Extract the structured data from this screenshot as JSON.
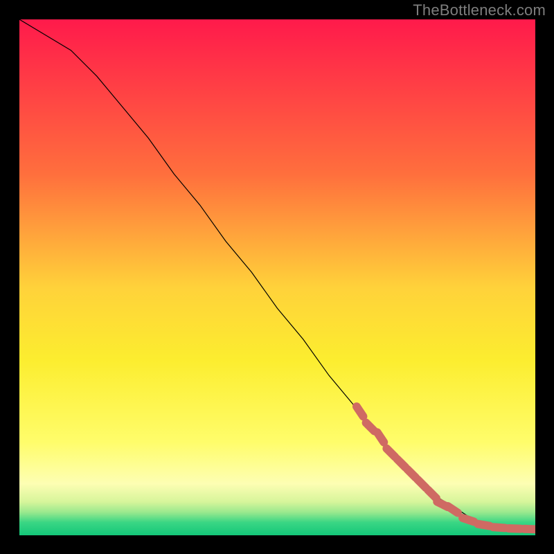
{
  "watermark": "TheBottleneck.com",
  "chart_data": {
    "type": "line",
    "title": "",
    "xlabel": "",
    "ylabel": "",
    "xlim": [
      0,
      100
    ],
    "ylim": [
      0,
      100
    ],
    "series": [
      {
        "name": "curve",
        "style": "line",
        "color": "#000000",
        "x": [
          0,
          5,
          10,
          15,
          20,
          25,
          30,
          35,
          40,
          45,
          50,
          55,
          60,
          65,
          70,
          75,
          80,
          85,
          88,
          90,
          92,
          95,
          100
        ],
        "y": [
          100,
          97,
          94,
          89,
          83,
          77,
          70,
          64,
          57,
          51,
          44,
          38,
          31,
          25,
          19,
          13,
          8,
          5,
          3,
          2,
          1.5,
          1.3,
          1.2
        ]
      },
      {
        "name": "highlighted-segment",
        "style": "dashed-marker",
        "color": "#cf6a63",
        "x": [
          66,
          68,
          70,
          72,
          74,
          76,
          78,
          80,
          82,
          84,
          87,
          90,
          93,
          96,
          99
        ],
        "y": [
          24,
          21,
          19,
          16,
          14,
          12,
          10,
          8,
          6,
          5,
          3,
          2,
          1.5,
          1.3,
          1.2
        ]
      }
    ],
    "gradient_bands": [
      {
        "stop": 0.0,
        "color": "#ff1a4b"
      },
      {
        "stop": 0.3,
        "color": "#ff6f3d"
      },
      {
        "stop": 0.52,
        "color": "#ffd23a"
      },
      {
        "stop": 0.66,
        "color": "#fced2f"
      },
      {
        "stop": 0.82,
        "color": "#fffd6b"
      },
      {
        "stop": 0.9,
        "color": "#fdfeb3"
      },
      {
        "stop": 0.935,
        "color": "#d7f59b"
      },
      {
        "stop": 0.955,
        "color": "#9be98e"
      },
      {
        "stop": 0.975,
        "color": "#3ad684"
      },
      {
        "stop": 1.0,
        "color": "#14c779"
      }
    ]
  }
}
